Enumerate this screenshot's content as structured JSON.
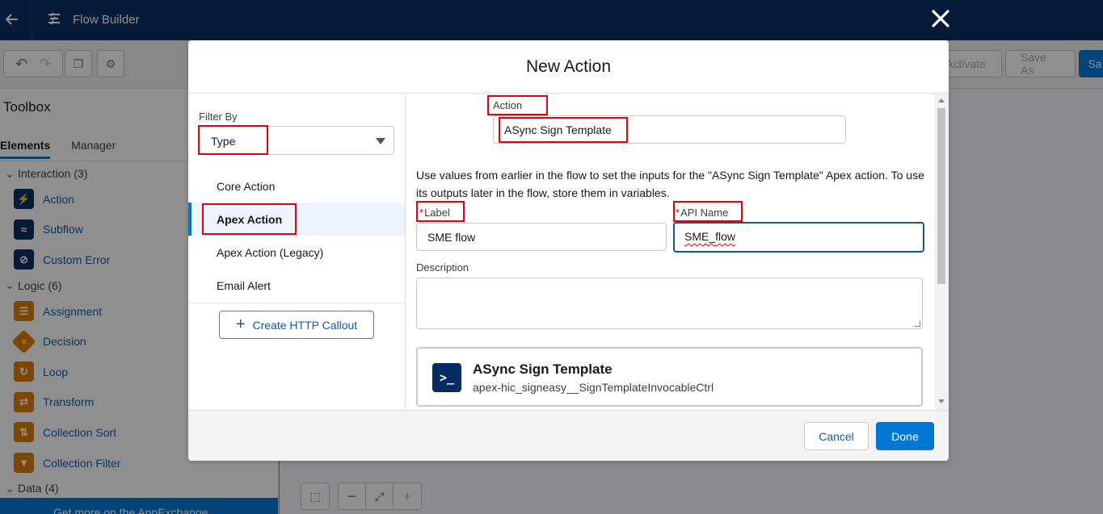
{
  "app": {
    "title": "Flow Builder"
  },
  "toolbar": {
    "activate_label": "Activate",
    "save_as_label": "Save As",
    "save_label": "Sa"
  },
  "toolbox": {
    "title": "Toolbox",
    "tabs": [
      {
        "label": "Elements"
      },
      {
        "label": "Manager"
      }
    ],
    "groups": [
      {
        "label": "Interaction (3)",
        "items": [
          {
            "label": "Action",
            "icon": "lightning-icon"
          },
          {
            "label": "Subflow",
            "icon": "subflow-icon"
          },
          {
            "label": "Custom Error",
            "icon": "error-icon"
          }
        ]
      },
      {
        "label": "Logic (6)",
        "items": [
          {
            "label": "Assignment",
            "icon": "assignment-icon"
          },
          {
            "label": "Decision",
            "icon": "decision-icon"
          },
          {
            "label": "Loop",
            "icon": "loop-icon"
          },
          {
            "label": "Transform",
            "icon": "transform-icon"
          },
          {
            "label": "Collection Sort",
            "icon": "sort-icon"
          },
          {
            "label": "Collection Filter",
            "icon": "filter-icon"
          }
        ]
      },
      {
        "label": "Data (4)",
        "items": []
      }
    ],
    "appexchange_label": "Get more on the AppExchange"
  },
  "modal": {
    "title": "New Action",
    "filter": {
      "label": "Filter By",
      "value": "Type"
    },
    "types": [
      {
        "label": "Core Action"
      },
      {
        "label": "Apex Action"
      },
      {
        "label": "Apex Action (Legacy)"
      },
      {
        "label": "Email Alert"
      }
    ],
    "create_callout_label": "Create HTTP Callout",
    "action": {
      "label": "Action",
      "value": "ASync Sign Template"
    },
    "help_text": "Use values from earlier in the flow to set the inputs for the \"ASync Sign Template\" Apex action. To use its outputs later in the flow, store them in variables.",
    "label_field": {
      "label": "Label",
      "value": "SME flow"
    },
    "api_name_field": {
      "label": "API Name",
      "value_a": "SME_",
      "value_b": "flow"
    },
    "description_field": {
      "label": "Description",
      "value": ""
    },
    "card": {
      "title": "ASync Sign Template",
      "subtitle": "apex-hic_signeasy__SignTemplateInvocableCtrl"
    },
    "cancel_label": "Cancel",
    "done_label": "Done"
  },
  "colors": {
    "brand_navy": "#032d60",
    "brand_blue": "#0176d3",
    "annotation_red": "#e8000b"
  }
}
